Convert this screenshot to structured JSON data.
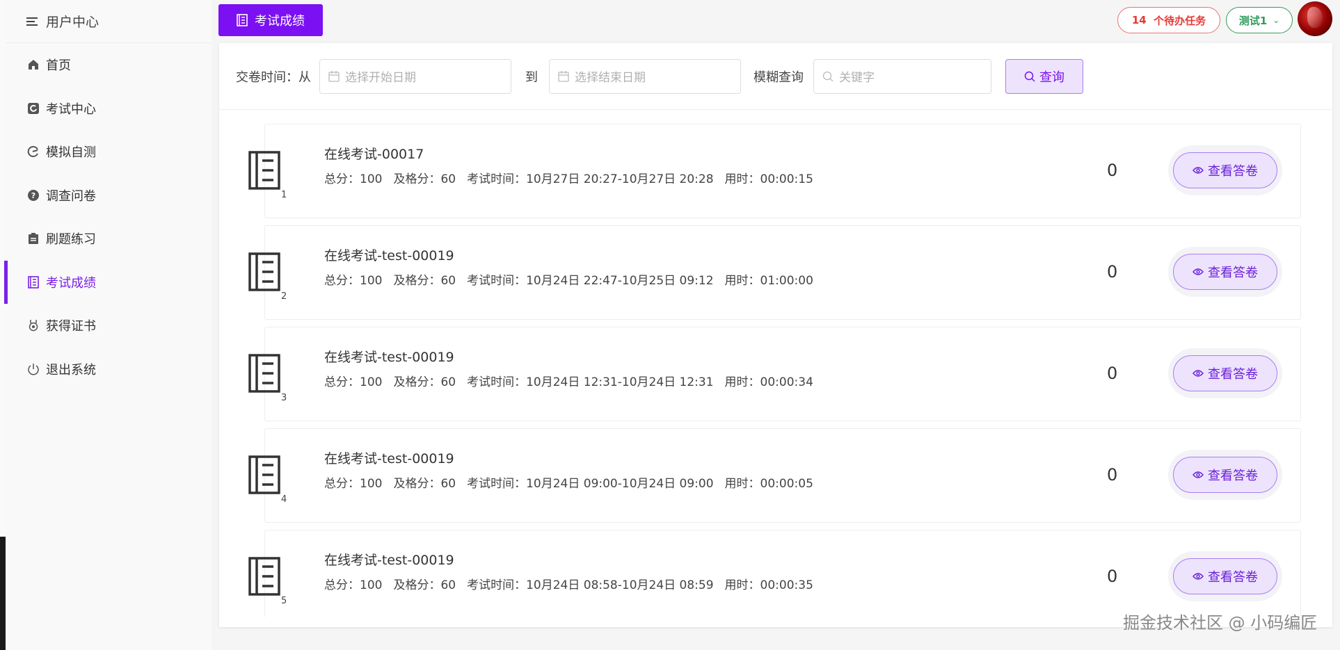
{
  "sidebar": {
    "title": "用户中心",
    "items": [
      {
        "label": "首页",
        "icon": "home-icon"
      },
      {
        "label": "考试中心",
        "icon": "exam-center-icon"
      },
      {
        "label": "模拟自测",
        "icon": "self-test-icon"
      },
      {
        "label": "调查问卷",
        "icon": "question-icon"
      },
      {
        "label": "刷题练习",
        "icon": "clipboard-icon"
      },
      {
        "label": "考试成绩",
        "icon": "score-icon",
        "active": true
      },
      {
        "label": "获得证书",
        "icon": "medal-icon"
      },
      {
        "label": "退出系统",
        "icon": "power-icon"
      }
    ]
  },
  "topbar": {
    "active_tab": "考试成绩",
    "tasks_count": "14",
    "tasks_label": "个待办任务",
    "user_name": "测试1"
  },
  "filter": {
    "submit_time_label": "交卷时间：从",
    "start_placeholder": "选择开始日期",
    "to_label": "到",
    "end_placeholder": "选择结束日期",
    "fuzzy_label": "模糊查询",
    "keyword_placeholder": "关键字",
    "search_label": "查询"
  },
  "records": [
    {
      "index": "1",
      "title": "在线考试-00017",
      "total": "总分：100",
      "pass": "及格分：60",
      "time": "考试时间：10月27日 20:27-10月27日 20:28",
      "used": "用时：00:00:15",
      "score": "0",
      "action": "查看答卷"
    },
    {
      "index": "2",
      "title": "在线考试-test-00019",
      "total": "总分：100",
      "pass": "及格分：60",
      "time": "考试时间：10月24日 22:47-10月25日 09:12",
      "used": "用时：01:00:00",
      "score": "0",
      "action": "查看答卷"
    },
    {
      "index": "3",
      "title": "在线考试-test-00019",
      "total": "总分：100",
      "pass": "及格分：60",
      "time": "考试时间：10月24日 12:31-10月24日 12:31",
      "used": "用时：00:00:34",
      "score": "0",
      "action": "查看答卷"
    },
    {
      "index": "4",
      "title": "在线考试-test-00019",
      "total": "总分：100",
      "pass": "及格分：60",
      "time": "考试时间：10月24日 09:00-10月24日 09:00",
      "used": "用时：00:00:05",
      "score": "0",
      "action": "查看答卷"
    },
    {
      "index": "5",
      "title": "在线考试-test-00019",
      "total": "总分：100",
      "pass": "及格分：60",
      "time": "考试时间：10月24日 08:58-10月24日 08:59",
      "used": "用时：00:00:35",
      "score": "0",
      "action": "查看答卷"
    }
  ],
  "watermark": "掘金技术社区 @ 小码编匠",
  "colors": {
    "accent": "#7b10f2",
    "danger": "#e53935",
    "success": "#2e9e5b"
  }
}
